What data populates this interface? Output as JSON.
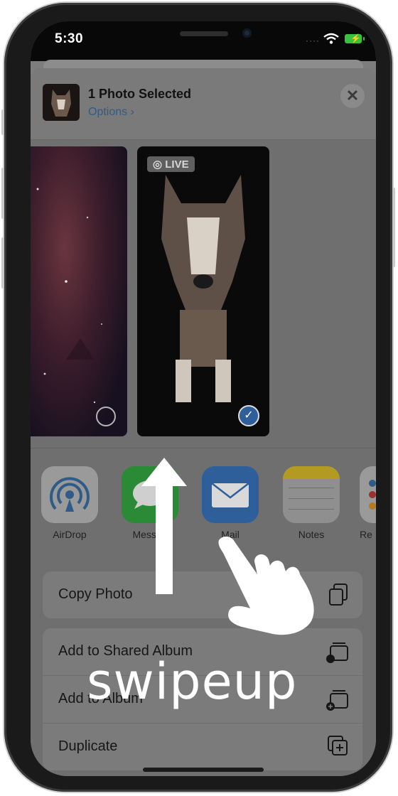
{
  "status_bar": {
    "time": "5:30"
  },
  "share_sheet": {
    "title": "1 Photo Selected",
    "options_label": "Options",
    "live_badge": "LIVE"
  },
  "apps": [
    {
      "label": "AirDrop",
      "icon": "airdrop-icon"
    },
    {
      "label": "Messag",
      "icon": "messages-icon"
    },
    {
      "label": "Mail",
      "icon": "mail-icon"
    },
    {
      "label": "Notes",
      "icon": "notes-icon"
    },
    {
      "label": "Re",
      "icon": "reminders-icon"
    }
  ],
  "actions": {
    "copy_photo": "Copy Photo",
    "add_shared_album": "Add to Shared Album",
    "add_to_album": "Add to Album",
    "duplicate": "Duplicate"
  },
  "overlay": {
    "gesture_label": "swipeup"
  },
  "colors": {
    "accent": "#2e5f9b",
    "battery": "#3cc03f"
  }
}
